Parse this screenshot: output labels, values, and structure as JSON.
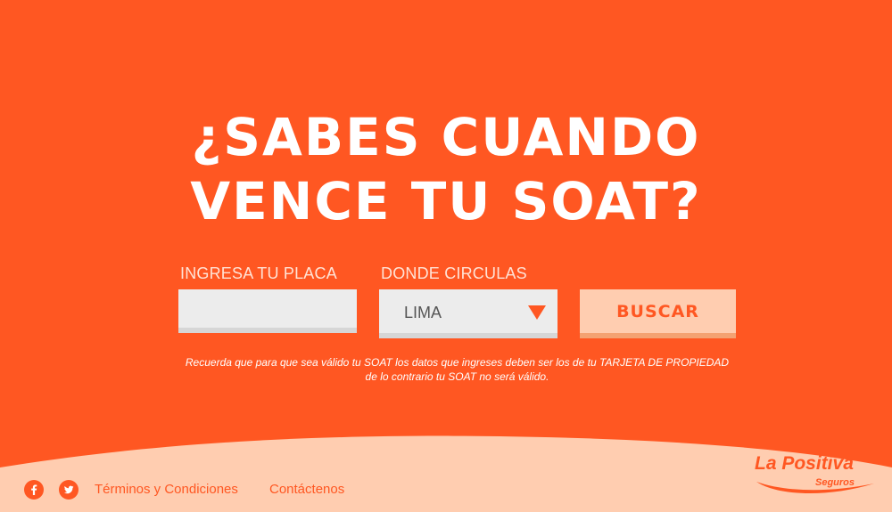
{
  "hero": {
    "headline_line1": "¿SABES CUANDO",
    "headline_line2": "VENCE TU SOAT?"
  },
  "form": {
    "plate_label": "INGRESA TU PLACA",
    "plate_value": "",
    "region_label": "DONDE CIRCULAS",
    "region_selected": "LIMA",
    "search_button_label": "BUSCAR"
  },
  "notice": {
    "text": "Recuerda que para que sea válido tu SOAT los datos que ingreses deben ser los de tu TARJETA DE PROPIEDAD de lo contrario tu SOAT no será válido."
  },
  "footer": {
    "social": [
      {
        "icon": "facebook-icon"
      },
      {
        "icon": "twitter-icon"
      }
    ],
    "links": {
      "terms": "Términos y Condiciones",
      "contact": "Contáctenos"
    },
    "logo": {
      "name": "La Positiva",
      "subtitle": "Seguros"
    }
  },
  "colors": {
    "background": "#ff5722",
    "footer_background": "#ffcdb0",
    "button_background": "#ffcdb0",
    "accent": "#ff5722",
    "text_on_accent": "#ffffff"
  }
}
